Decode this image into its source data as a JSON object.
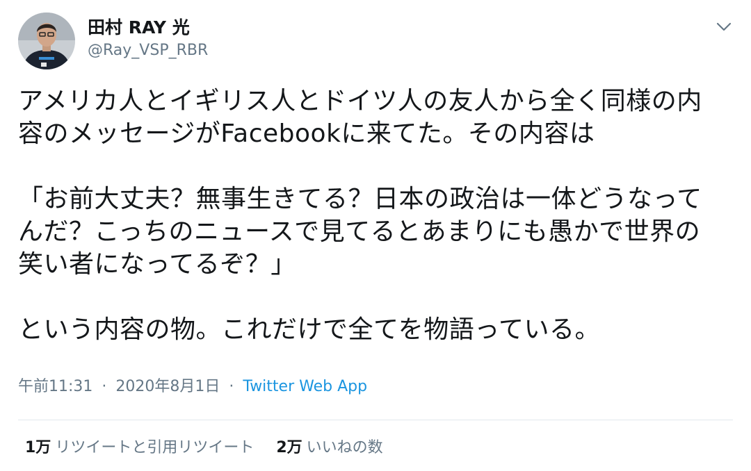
{
  "tweet": {
    "author": {
      "display_name": "田村 RAY 光",
      "handle": "@Ray_VSP_RBR"
    },
    "text": "アメリカ人とイギリス人とドイツ人の友人から全く同様の内\n容のメッセージがFacebookに来てた。その内容は\n\n「お前大丈夫？無事生きてる？日本の政治は一体どうなって\nんだ？こっちのニュースで見てるとあまりにも愚かで世界の\n笑い者になってるぞ？」\n\nという内容の物。これだけで全てを物語っている。",
    "time": "午前11:31",
    "date": "2020年8月1日",
    "separator": "·",
    "source": "Twitter Web App",
    "retweets": {
      "count": "1万",
      "label": "リツイートと引用リツイート"
    },
    "likes": {
      "count": "2万",
      "label": "いいねの数"
    }
  },
  "icons": {
    "menu": "chevron-down-icon"
  },
  "colors": {
    "text": "#14171a",
    "secondary": "#657786",
    "link": "#1b95e0",
    "divider": "#e1e8ed"
  }
}
